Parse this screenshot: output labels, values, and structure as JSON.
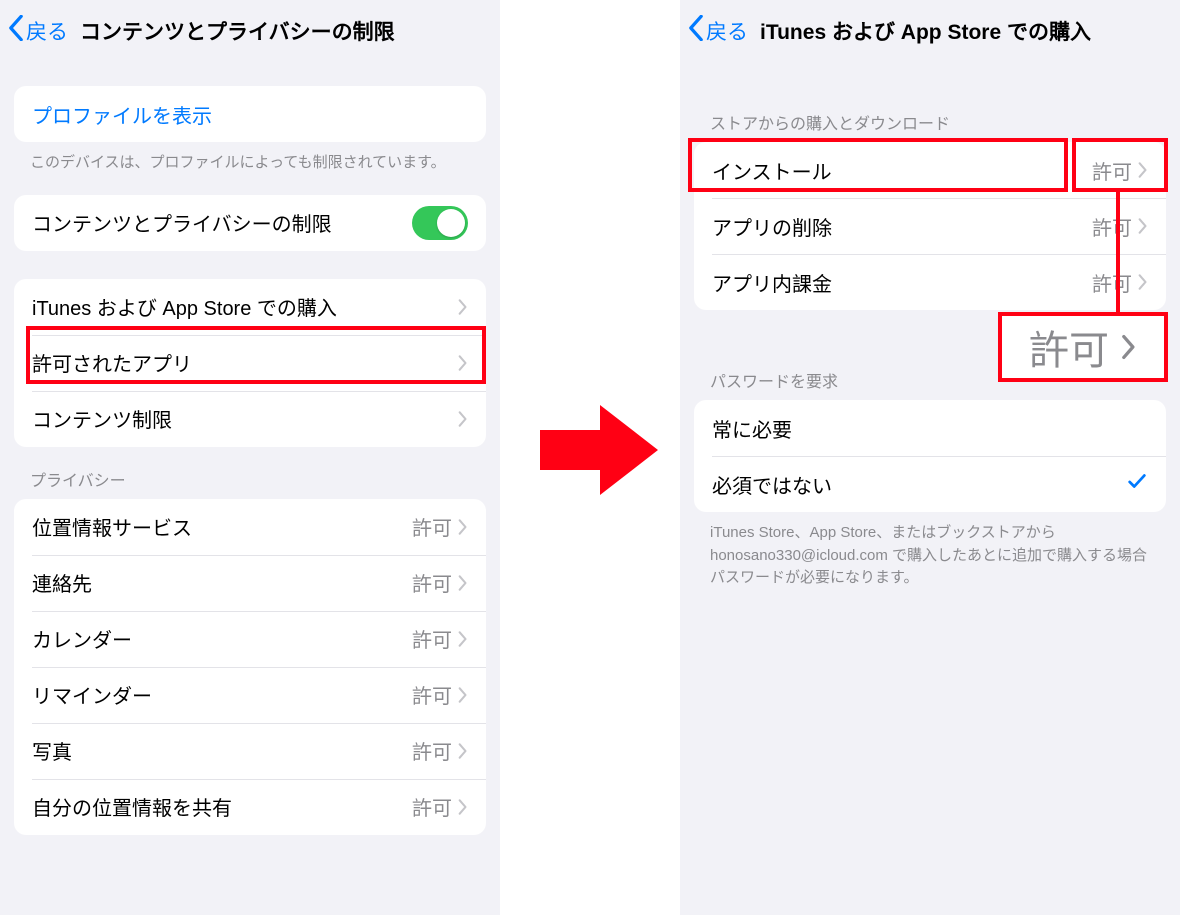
{
  "left": {
    "back": "戻る",
    "title": "コンテンツとプライバシーの制限",
    "profile_link": "プロファイルを表示",
    "profile_footer": "このデバイスは、プロファイルによっても制限されています。",
    "toggle_label": "コンテンツとプライバシーの制限",
    "rows_main": [
      {
        "label": "iTunes および App Store での購入"
      },
      {
        "label": "許可されたアプリ"
      },
      {
        "label": "コンテンツ制限"
      }
    ],
    "privacy_header": "プライバシー",
    "privacy_rows": [
      {
        "label": "位置情報サービス",
        "value": "許可"
      },
      {
        "label": "連絡先",
        "value": "許可"
      },
      {
        "label": "カレンダー",
        "value": "許可"
      },
      {
        "label": "リマインダー",
        "value": "許可"
      },
      {
        "label": "写真",
        "value": "許可"
      },
      {
        "label": "自分の位置情報を共有",
        "value": "許可"
      }
    ]
  },
  "right": {
    "back": "戻る",
    "title": "iTunes および App Store での購入",
    "store_header": "ストアからの購入とダウンロード",
    "store_rows": [
      {
        "label": "インストール",
        "value": "許可"
      },
      {
        "label": "アプリの削除",
        "value": "許可"
      },
      {
        "label": "アプリ内課金",
        "value": "許可"
      }
    ],
    "big_permit": "許可",
    "password_header": "パスワードを要求",
    "password_rows": [
      {
        "label": "常に必要",
        "checked": false
      },
      {
        "label": "必須ではない",
        "checked": true
      }
    ],
    "password_footer": "iTunes Store、App Store、またはブックストアから honosano330@icloud.com で購入したあとに追加で購入する場合パスワードが必要になります。"
  }
}
